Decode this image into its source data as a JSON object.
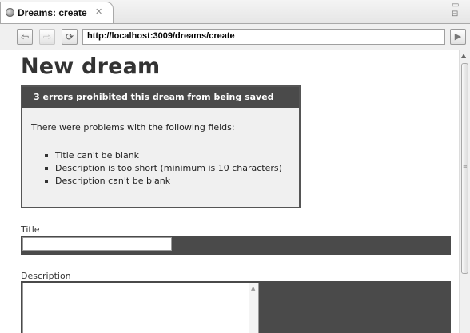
{
  "window": {
    "tab_title": "Dreams: create",
    "tab_close": "✕",
    "minmax": "▭ ⊟"
  },
  "toolbar": {
    "back_icon": "⇦",
    "forward_icon": "⇨",
    "refresh_icon": "⟳",
    "url": "http://localhost:3009/dreams/create",
    "go_icon": "▶"
  },
  "page": {
    "title": "New dream",
    "errors": {
      "header": "3 errors prohibited this dream from being saved",
      "intro": "There were problems with the following fields:",
      "items": [
        "Title can't be blank",
        "Description is too short (minimum is 10 characters)",
        "Description can't be blank"
      ]
    },
    "form": {
      "title_label": "Title",
      "title_value": "",
      "description_label": "Description",
      "description_value": ""
    }
  },
  "colors": {
    "error_header_bg": "#4a4a4a",
    "error_box_bg": "#f0f0f0",
    "field_error_bg": "#4a4a4a"
  }
}
